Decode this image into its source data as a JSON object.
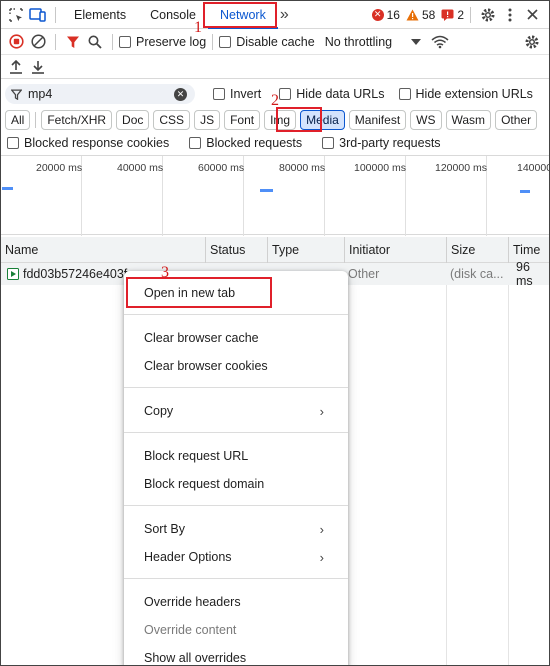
{
  "tabbar": {
    "tabs": [
      {
        "label": "Elements"
      },
      {
        "label": "Console"
      },
      {
        "label": "Network"
      }
    ],
    "more_label": "»",
    "errors": "16",
    "warnings": "58",
    "issues": "2",
    "colors": {
      "accent": "#0b57d0",
      "error": "#d93025",
      "warning": "#e8710a"
    }
  },
  "toolbar": {
    "preserve_log": "Preserve log",
    "disable_cache": "Disable cache",
    "throttling": "No throttling"
  },
  "filter": {
    "value": "mp4",
    "invert": "Invert",
    "hide_data_urls": "Hide data URLs",
    "hide_extension_urls": "Hide extension URLs"
  },
  "type_filters": [
    "All",
    "Fetch/XHR",
    "Doc",
    "CSS",
    "JS",
    "Font",
    "Img",
    "Media",
    "Manifest",
    "WS",
    "Wasm",
    "Other"
  ],
  "selected_type": "Media",
  "blocked": {
    "blocked_response_cookies": "Blocked response cookies",
    "blocked_requests": "Blocked requests",
    "third_party": "3rd-party requests"
  },
  "timeline": {
    "ticks": [
      "20000 ms",
      "40000 ms",
      "60000 ms",
      "80000 ms",
      "100000 ms",
      "120000 ms",
      "140000"
    ]
  },
  "table": {
    "columns": [
      "Name",
      "Status",
      "Type",
      "Initiator",
      "Size",
      "Time"
    ],
    "rows": [
      {
        "name": "fdd03b57246e403f",
        "initiator": "Other",
        "size": "(disk ca...",
        "time": "96 ms"
      }
    ]
  },
  "context_menu": {
    "open_new_tab": "Open in new tab",
    "clear_cache": "Clear browser cache",
    "clear_cookies": "Clear browser cookies",
    "copy": "Copy",
    "block_url": "Block request URL",
    "block_domain": "Block request domain",
    "sort_by": "Sort By",
    "header_options": "Header Options",
    "override_headers": "Override headers",
    "override_content": "Override content",
    "show_overrides": "Show all overrides",
    "submenu_arrow": "›"
  },
  "annotations": [
    "1",
    "2",
    "3"
  ]
}
